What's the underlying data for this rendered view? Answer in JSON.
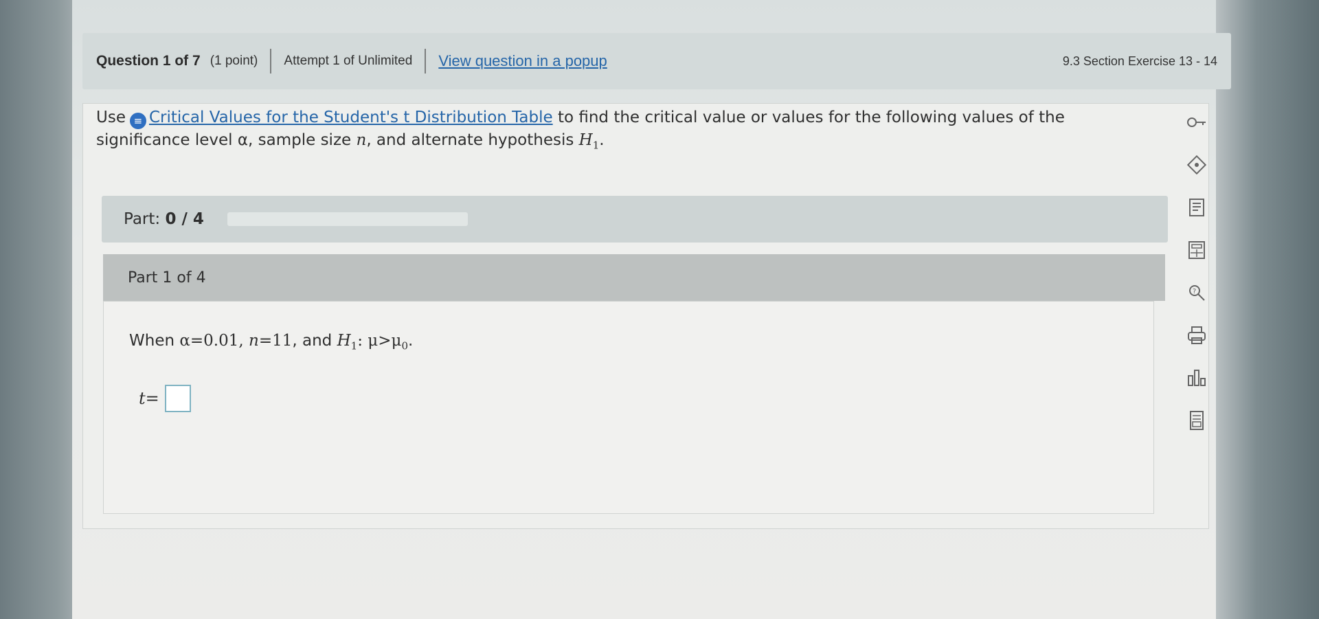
{
  "header": {
    "question": "Question 1 of 7",
    "points": "(1 point)",
    "attempt": "Attempt 1 of Unlimited",
    "popup_link": "View question in a popup",
    "section": "9.3 Section Exercise 13 - 14"
  },
  "instruction": {
    "use": "Use",
    "link": "Critical Values for the Student's t Distribution Table",
    "text_after_link": " to find the critical value or values for the following values of the",
    "line2_prefix": "significance level α, sample size ",
    "n": "n",
    "line2_mid": ", and alternate hypothesis ",
    "H": "H",
    "sub1": "1",
    "period": "."
  },
  "progress": {
    "label": "Part:",
    "value": "0 / 4",
    "fraction": 0
  },
  "part": {
    "title": "Part 1 of 4",
    "when": "When ",
    "alpha_expr": "α=0.01,",
    "n": "n",
    "n_expr": "=11",
    "and": ", and ",
    "H": "H",
    "sub1": "1",
    "colon": ": ",
    "mu_expr": "μ>μ",
    "sub0": "0",
    "period": "."
  },
  "answer": {
    "t": "t",
    "equals": " ="
  },
  "toolbar": {
    "icons": [
      "key-icon",
      "tag-icon",
      "notes-icon",
      "calculator-icon",
      "search-help-icon",
      "print-icon",
      "chart-icon",
      "table-icon"
    ]
  },
  "colors": {
    "link": "#2565a8",
    "info_dot": "#2f6fc1",
    "answer_border": "#7fb3c2"
  }
}
